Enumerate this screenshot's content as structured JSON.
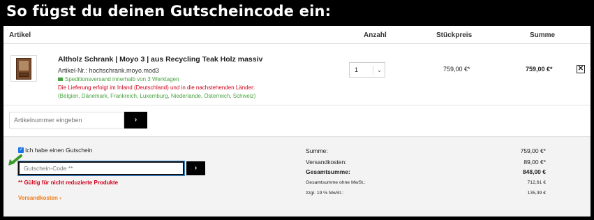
{
  "banner": {
    "title": "So fügst du deinen Gutscheincode ein:"
  },
  "table_headers": {
    "artikel": "Artikel",
    "anzahl": "Anzahl",
    "stueckpreis": "Stückpreis",
    "summe": "Summe"
  },
  "product": {
    "name": "Altholz Schrank | Moyo 3 | aus Recycling Teak Holz massiv",
    "artnr": "Artikel-Nr.: hochschrank.moyo.mod3",
    "shipping": "Speditionsversand innerhalb von 3 Werktagen",
    "delivery_warning": "Die Lieferung erfolgt im Inland (Deutschland) und in die nachstehenden Länder:",
    "countries": "(Belgien, Dänemark, Frankreich, Luxemburg, Niederlande, Österreich, Schweiz)",
    "quantity": "1",
    "unit_price": "759,00 €*",
    "total_price": "759,00 €*",
    "remove_label": "✕"
  },
  "article_input": {
    "placeholder": "Artikelnummer eingeben",
    "button": "›"
  },
  "voucher": {
    "checkbox_label": "Ich habe einen Gutschein",
    "input_placeholder": "Gutschein-Code **",
    "button": "›",
    "note": "** Gültig für nicht reduzierte Produkte",
    "shipping_link": "Versandkosten ›"
  },
  "summary": {
    "summe_label": "Summe:",
    "summe_value": "759,00 €*",
    "versand_label": "Versandkosten:",
    "versand_value": "89,00 €*",
    "gesamt_label": "Gesamtsumme:",
    "gesamt_value": "848,00 €",
    "netto_label": "Gesamtsumme ohne MwSt.:",
    "netto_value": "712,61 €",
    "mwst_label": "zzgl. 19 % MwSt.:",
    "mwst_value": "135,39 €"
  },
  "colors": {
    "accent_green": "#4aa341",
    "warning_red": "#d0021b",
    "link_orange": "#f07d1a",
    "checkbox_blue": "#1a73e8"
  },
  "icons": {
    "thumbnail": "cabinet-thumbnail",
    "shipping": "truck-icon",
    "remove": "close-icon",
    "dropdown": "chevron-down-icon",
    "arrow": "arrow-pointer-icon"
  }
}
